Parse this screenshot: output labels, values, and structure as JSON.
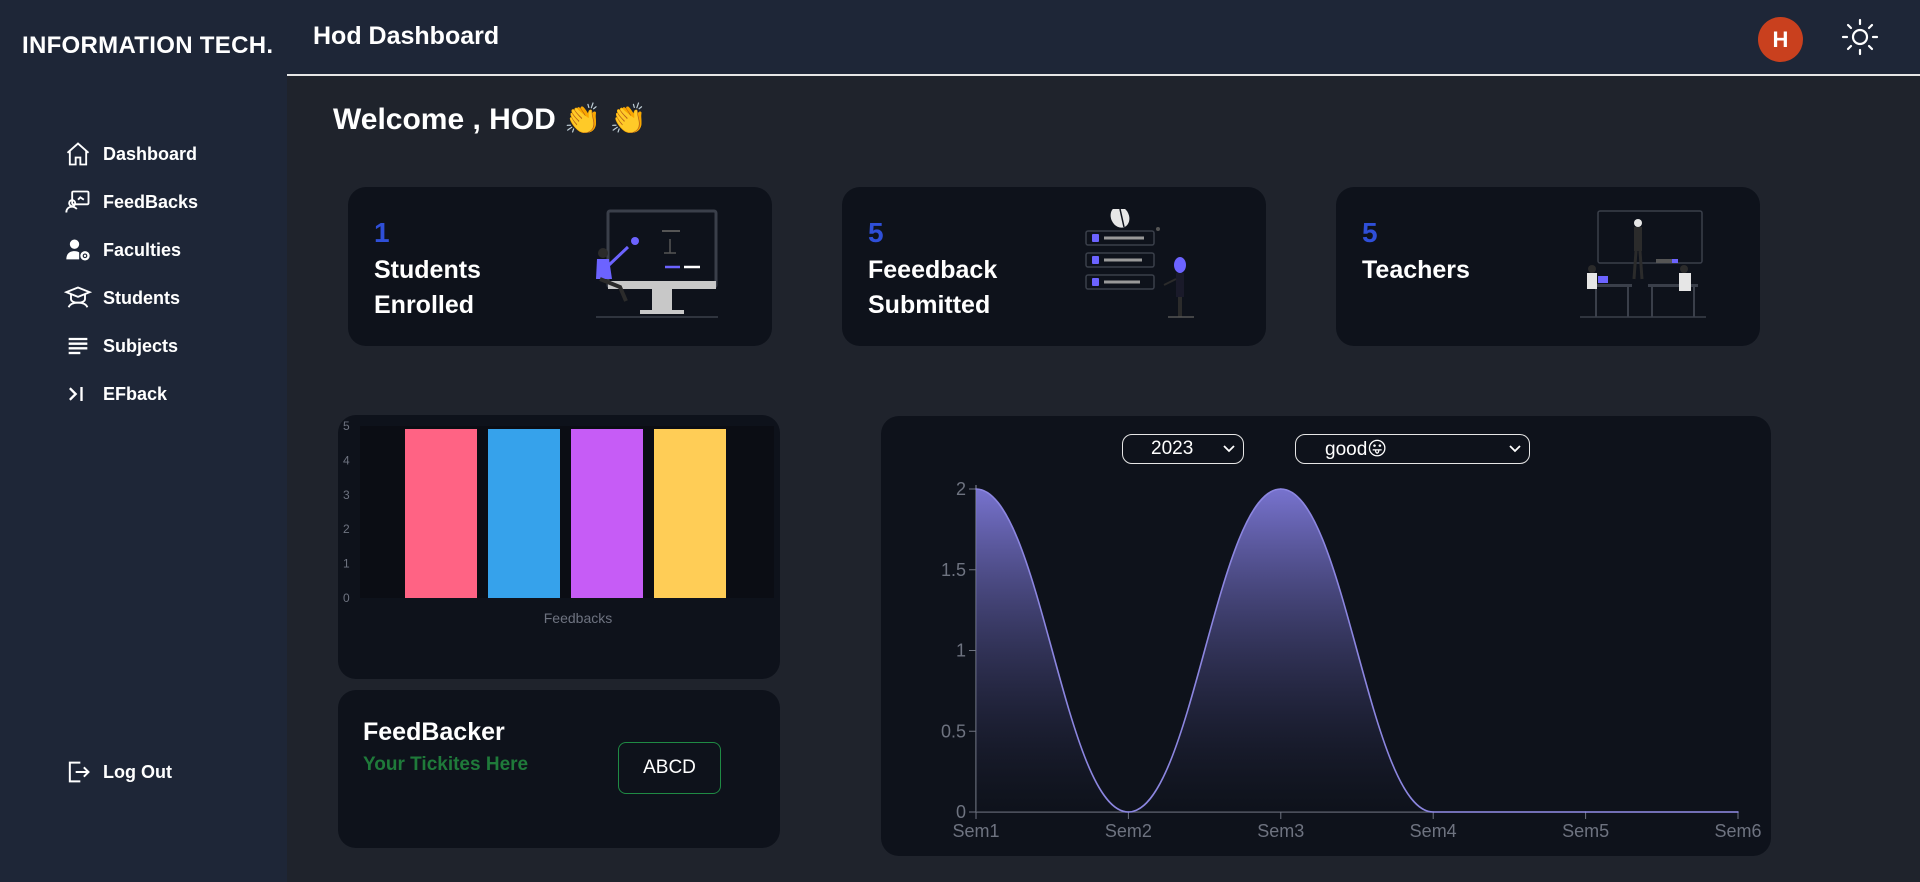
{
  "sidebar": {
    "brand": "INFORMATION TECH.",
    "items": [
      {
        "label": "Dashboard",
        "icon": "home-icon"
      },
      {
        "label": "FeedBacks",
        "icon": "feedback-icon"
      },
      {
        "label": "Faculties",
        "icon": "faculty-icon"
      },
      {
        "label": "Students",
        "icon": "student-icon"
      },
      {
        "label": "Subjects",
        "icon": "list-icon"
      },
      {
        "label": "EFback",
        "icon": "arrow-bar-icon"
      }
    ],
    "logout": "Log Out"
  },
  "header": {
    "title": "Hod Dashboard",
    "avatar_letter": "H"
  },
  "welcome": "Welcome , HOD 👏 👏",
  "stats": [
    {
      "number": "1",
      "label": "Students Enrolled"
    },
    {
      "number": "5",
      "label": "Feeedback Submitted"
    },
    {
      "number": "5",
      "label": "Teachers"
    }
  ],
  "ticket": {
    "title": "FeedBacker",
    "subtitle": "Your Tickites Here",
    "button": "ABCD"
  },
  "filters": {
    "year": "2023",
    "rating": "good😛"
  },
  "colors": {
    "accent": "#2f4fd8",
    "line": "#8c86e0",
    "success": "#1f7a3a",
    "avatar": "#c9401e"
  },
  "chart_data": [
    {
      "type": "bar",
      "categories": [
        "",
        "",
        "",
        ""
      ],
      "values": [
        5,
        5,
        5,
        5
      ],
      "colors": [
        "#ff6384",
        "#36a2eb",
        "#c65cf6",
        "#ffcd56"
      ],
      "xlabel": "Feedbacks",
      "ylim": [
        0,
        5
      ],
      "yticks": [
        0,
        1,
        2,
        3,
        4,
        5
      ]
    },
    {
      "type": "area",
      "x": [
        "Sem1",
        "Sem2",
        "Sem3",
        "Sem4",
        "Sem5",
        "Sem6"
      ],
      "values": [
        2,
        0,
        2,
        0,
        0,
        0
      ],
      "ylim": [
        0,
        2
      ],
      "yticks": [
        "0",
        "0.5",
        "1",
        "1.5",
        "2"
      ]
    }
  ]
}
